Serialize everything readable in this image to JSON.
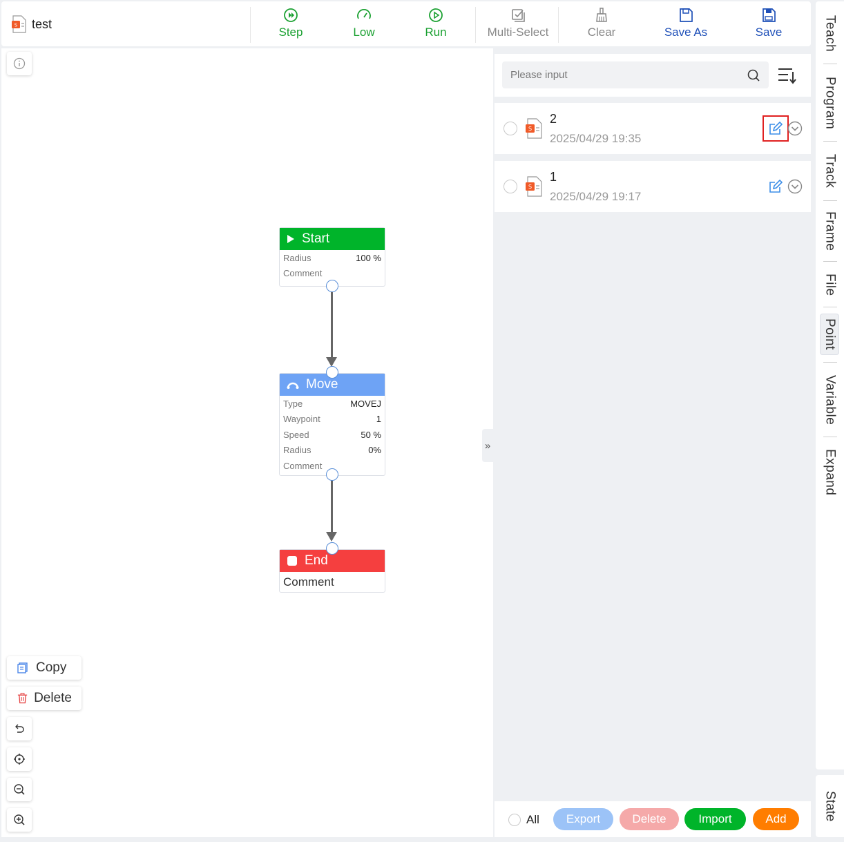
{
  "header": {
    "file_name": "test",
    "tools": {
      "step": "Step",
      "low": "Low",
      "run": "Run",
      "multi_select": "Multi-Select",
      "clear": "Clear",
      "save_as": "Save As",
      "save": "Save"
    }
  },
  "canvas": {
    "copy_label": "Copy",
    "delete_label": "Delete",
    "nodes": {
      "start": {
        "title": "Start",
        "rows": [
          {
            "k": "Radius",
            "v": "100 %"
          },
          {
            "k": "Comment",
            "v": ""
          }
        ]
      },
      "move": {
        "title": "Move",
        "rows": [
          {
            "k": "Type",
            "v": "MOVEJ"
          },
          {
            "k": "Waypoint",
            "v": "1"
          },
          {
            "k": "Speed",
            "v": "50 %"
          },
          {
            "k": "Radius",
            "v": "0%"
          },
          {
            "k": "Comment",
            "v": ""
          }
        ]
      },
      "end": {
        "title": "End",
        "comment": "Comment"
      }
    }
  },
  "panel": {
    "search_placeholder": "Please input",
    "items": [
      {
        "name": "2",
        "date": "2025/04/29 19:35"
      },
      {
        "name": "1",
        "date": "2025/04/29 19:17"
      }
    ],
    "footer": {
      "all": "All",
      "export": "Export",
      "delete": "Delete",
      "import": "Import",
      "add": "Add"
    }
  },
  "side_tabs": [
    "Teach",
    "Program",
    "Track",
    "Frame",
    "File",
    "Point",
    "Variable",
    "Expand"
  ],
  "state_tab": "State",
  "colors": {
    "start_green": "#00b42a",
    "move_blue": "#6ea3f5",
    "end_red": "#f53f3f",
    "toolbar_green": "#19a030",
    "toolbar_blue": "#1f50b8",
    "export_btn": "#9cc3f7",
    "delete_btn": "#f5a9a9",
    "import_btn": "#00b42a",
    "add_btn": "#ff7d00"
  }
}
